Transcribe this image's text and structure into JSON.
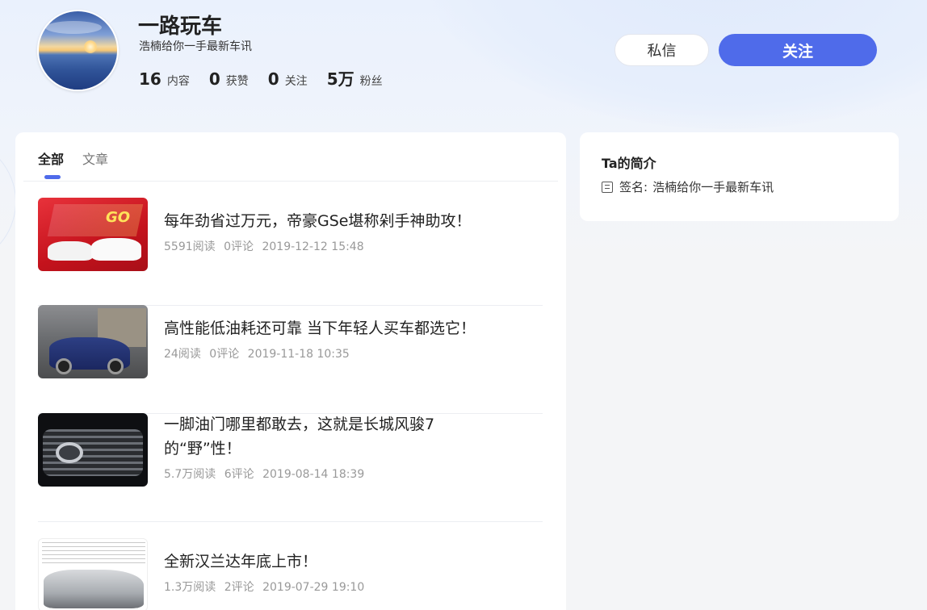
{
  "profile": {
    "name": "一路玩车",
    "bio": "浩楠给你一手最新车讯",
    "stats": [
      {
        "num": "16",
        "label": "内容"
      },
      {
        "num": "0",
        "label": "获赞"
      },
      {
        "num": "0",
        "label": "关注"
      },
      {
        "num": "5万",
        "label": "粉丝"
      }
    ],
    "message_label": "私信",
    "follow_label": "关注"
  },
  "tabs": [
    {
      "label": "全部",
      "active": true
    },
    {
      "label": "文章",
      "active": false
    }
  ],
  "feed": [
    {
      "title": "每年劲省过万元，帝豪GSe堪称剁手神助攻！",
      "reads": "5591阅读",
      "comments": "0评论",
      "time": "2019-12-12 15:48",
      "thumb_text": "GO"
    },
    {
      "title": "高性能低油耗还可靠 当下年轻人买车都选它！",
      "reads": "24阅读",
      "comments": "0评论",
      "time": "2019-11-18 10:35"
    },
    {
      "title": "一脚油门哪里都敢去，这就是长城风骏7的“野”性！",
      "reads": "5.7万阅读",
      "comments": "6评论",
      "time": "2019-08-14 18:39"
    },
    {
      "title": "全新汉兰达年底上市！",
      "reads": "1.3万阅读",
      "comments": "2评论",
      "time": "2019-07-29 19:10"
    }
  ],
  "sidebar": {
    "title": "Ta的简介",
    "sign_label": "签名:",
    "sign_value": "浩楠给你一手最新车讯"
  },
  "colors": {
    "accent": "#4f6bea"
  }
}
